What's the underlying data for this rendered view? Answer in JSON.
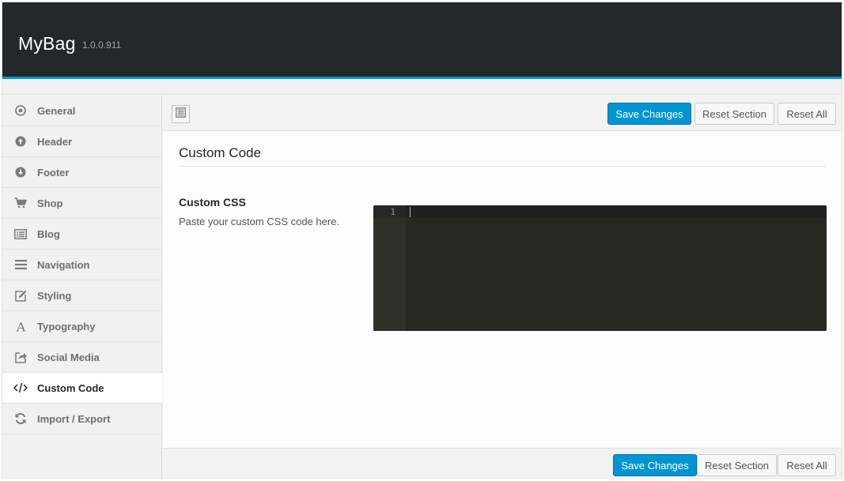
{
  "header": {
    "title": "MyBag",
    "version": "1.0.0.911"
  },
  "sidebar": {
    "items": [
      {
        "label": "General",
        "icon": "target-icon"
      },
      {
        "label": "Header",
        "icon": "arrow-up-circle-icon"
      },
      {
        "label": "Footer",
        "icon": "arrow-down-circle-icon"
      },
      {
        "label": "Shop",
        "icon": "cart-icon"
      },
      {
        "label": "Blog",
        "icon": "list-alt-icon"
      },
      {
        "label": "Navigation",
        "icon": "hamburger-icon"
      },
      {
        "label": "Styling",
        "icon": "edit-icon"
      },
      {
        "label": "Typography",
        "icon": "font-icon"
      },
      {
        "label": "Social Media",
        "icon": "share-icon"
      },
      {
        "label": "Custom Code",
        "icon": "code-icon",
        "active": true
      },
      {
        "label": "Import / Export",
        "icon": "refresh-icon"
      }
    ]
  },
  "toolbar": {
    "save_label": "Save Changes",
    "reset_section_label": "Reset Section",
    "reset_all_label": "Reset All"
  },
  "section": {
    "title": "Custom Code",
    "field_title": "Custom CSS",
    "field_description": "Paste your custom CSS code here."
  },
  "editor": {
    "line_number": "1",
    "content": ""
  },
  "footer": {
    "save_label": "Save Changes",
    "reset_section_label": "Reset Section",
    "reset_all_label": "Reset All"
  },
  "colors": {
    "header_bg": "#23282d",
    "accent": "#0095d0",
    "editor_bg": "#272822"
  }
}
